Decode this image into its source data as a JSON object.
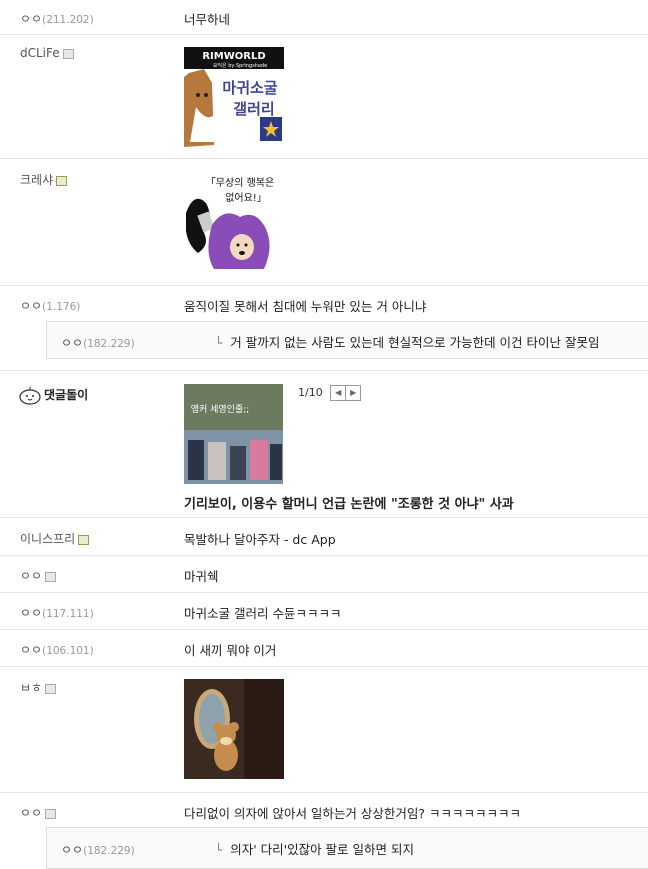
{
  "comments": [
    {
      "nick": "ㅇㅇ",
      "ip": "(211.202)",
      "text": "너무하네"
    },
    {
      "nick": "dCLiFe",
      "image_caption": "RIMWORLD",
      "image_sub": "요익은 by Springshade",
      "image_text1": "마귀소굴",
      "image_text2": "갤러리"
    },
    {
      "nick": "크레샤",
      "image_text1": "「무상의 행복은",
      "image_text2": "없어요!」"
    },
    {
      "nick": "ㅇㅇ",
      "ip": "(1.176)",
      "text": "움직이질 못해서 침대에 누워만 있는 거 아니냐"
    },
    {
      "nick": "ㅇㅇ",
      "ip": "(182.229)",
      "text": "거 팔까지 없는 사람도 있는데 현실적으로 가능한데 이건 타이난 잘못임"
    },
    {
      "nick": "댓글돌이",
      "pager": "1/10",
      "thumb_text": "앵커 세영인줄;;",
      "news_title": "기리보이, 이용수 할머니 언급 논란에 \"조롱한 것 아냐\" 사과"
    },
    {
      "nick": "이니스프리",
      "text": "목발하나 달아주자 - dc App"
    },
    {
      "nick": "ㅇㅇ",
      "text": "마귀쉑"
    },
    {
      "nick": "ㅇㅇ",
      "ip": "(117.111)",
      "text": "마귀소굴 갤러리 수듄ㅋㅋㅋㅋ"
    },
    {
      "nick": "ㅇㅇ",
      "ip": "(106.101)",
      "text": "이 새끼 뭐야 이거"
    },
    {
      "nick": "ㅂㅎ"
    },
    {
      "nick": "ㅇㅇ",
      "text": "다리없이 의자에 앉아서 일하는거 상상한거임? ㅋㅋㅋㅋㅋㅋㅋㅋ"
    },
    {
      "nick": "ㅇㅇ",
      "ip": "(182.229)",
      "text": "의자' 다리'있잖아 팔로 일하면 되지"
    }
  ],
  "icons": {
    "reply_arrow": "└",
    "prev": "◀",
    "next": "▶"
  },
  "colors": {
    "accent": "#3b4890",
    "ip": "#999999"
  }
}
